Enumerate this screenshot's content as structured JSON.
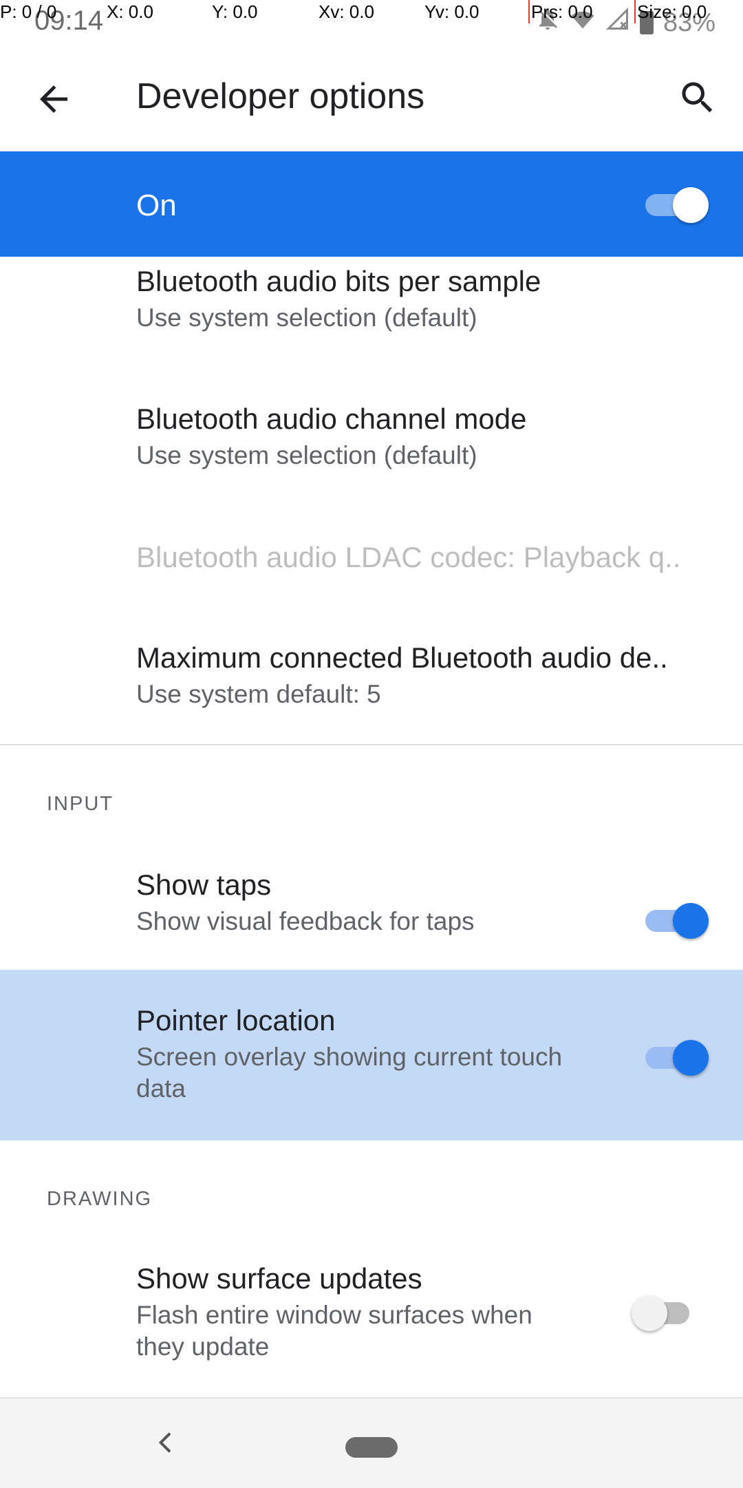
{
  "status_bar": {
    "time": "09:14",
    "battery": "83%",
    "icons": [
      "notifications-off-icon",
      "wifi-icon",
      "signal-off-icon",
      "battery-icon"
    ]
  },
  "pointer_overlay": {
    "p": "P: 0 / 0",
    "x": "X: 0.0",
    "y": "Y: 0.0",
    "xv": "Xv: 0.0",
    "yv": "Yv: 0.0",
    "prs": "Prs: 0.0",
    "size": "Size: 0.0"
  },
  "toolbar": {
    "title": "Developer options",
    "back_icon": "arrow-back-icon",
    "search_icon": "search-icon"
  },
  "master_switch": {
    "label": "On",
    "checked": true
  },
  "settings": [
    {
      "title": "Bluetooth audio bits per sample",
      "summary": "Use system selection (default)"
    },
    {
      "title": "Bluetooth audio channel mode",
      "summary": "Use system selection (default)"
    },
    {
      "title": "Bluetooth audio LDAC codec: Playback q..",
      "enabled": false
    },
    {
      "title": "Maximum connected Bluetooth audio de..",
      "summary": "Use system default: 5"
    }
  ],
  "sections": {
    "input": "INPUT",
    "drawing": "DRAWING"
  },
  "input": [
    {
      "title": "Show taps",
      "summary": "Show visual feedback for taps",
      "checked": true
    },
    {
      "title": "Pointer location",
      "summary_line1": "Screen overlay showing current touch",
      "summary_line2": "data",
      "checked": true
    }
  ],
  "drawing": [
    {
      "title": "Show surface updates",
      "summary_line1": "Flash entire window surfaces when",
      "summary_line2": "they update",
      "checked": false
    }
  ],
  "colors": {
    "accent": "#1a73e8",
    "highlight": "#c4d9f6"
  }
}
